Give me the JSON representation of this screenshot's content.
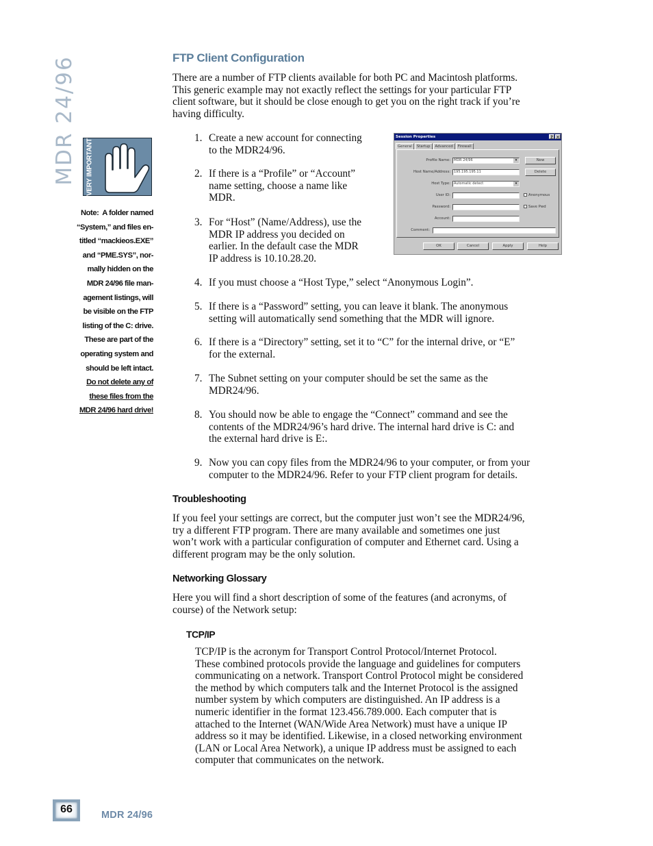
{
  "running_title": "MDR 24/96",
  "sidebar": {
    "icon_label": "VERY IMPORTANT",
    "note_label": "Note:",
    "note_lines": [
      "A folder named",
      "“System,” and files en-",
      "titled “mackieos.EXE”",
      "and “PME.SYS”, nor-",
      "mally hidden on the",
      "MDR 24/96 file man-",
      "agement listings, will",
      "be visible on the FTP",
      "listing of the C: drive.",
      "These are part of the",
      "operating system and",
      "should be left intact."
    ],
    "warning_lines": [
      "Do not delete any of",
      "these files from the",
      "MDR 24/96 hard drive!"
    ]
  },
  "main": {
    "section_title": "FTP Client Configuration",
    "intro_lines": [
      "There are a number of FTP clients available for both PC and Macintosh platforms.",
      "This generic example may not exactly reflect the settings for your particular FTP",
      "client software, but it should be close enough to get you on the right track if you’re",
      "having difficulty."
    ],
    "steps": [
      {
        "num": "1.",
        "lines": [
          "Create a new account for connecting",
          "to the MDR24/96."
        ]
      },
      {
        "num": "2.",
        "lines": [
          "If there is a “Profile” or “Account”",
          "name setting, choose a name like",
          "MDR."
        ]
      },
      {
        "num": "3.",
        "lines": [
          "For “Host” (Name/Address), use the",
          "MDR IP address you decided on",
          "earlier. In the default case the MDR",
          "IP address is 10.10.28.20."
        ]
      },
      {
        "num": "4.",
        "lines": [
          "If you must choose a “Host Type,” select “Anonymous Login”."
        ]
      },
      {
        "num": "5.",
        "lines": [
          "If there is a “Password” setting, you can leave it blank. The anonymous",
          "setting will automatically send something that the MDR will ignore."
        ]
      },
      {
        "num": "6.",
        "lines": [
          "If there is a “Directory” setting, set it to “C” for the internal drive, or “E”",
          "for the external."
        ]
      },
      {
        "num": "7.",
        "lines": [
          "The Subnet setting on your computer should be set the same as the",
          "MDR24/96."
        ]
      },
      {
        "num": "8.",
        "lines": [
          "You should now be able to engage the “Connect” command and see the",
          "contents of the MDR24/96’s hard drive. The internal hard drive is C: and",
          "the external hard drive is E:."
        ]
      },
      {
        "num": "9.",
        "lines": [
          "Now you can copy files from the MDR24/96 to your computer, or from your",
          "computer to the MDR24/96. Refer to your FTP client program for details."
        ]
      }
    ],
    "troubleshooting": {
      "title": "Troubleshooting",
      "lines": [
        "If you feel your settings are correct, but the computer just won’t see the MDR24/96,",
        "try a different FTP program. There are many available and sometimes one just",
        "won’t work with a particular configuration of computer and Ethernet card. Using a",
        "different program may be the only solution."
      ]
    },
    "glossary": {
      "title": "Networking Glossary",
      "lines": [
        "Here you will find a short description of some of the features (and acronyms, of",
        "course) of the Network setup:"
      ],
      "tcpip": {
        "title": "TCP/IP",
        "lines": [
          "TCP/IP is the acronym for Transport Control Protocol/Internet Protocol.",
          "These combined protocols provide the language and guidelines for computers",
          "communicating on a network. Transport Control Protocol might be considered",
          "the method by which computers talk and the Internet Protocol is the assigned",
          "number system by which computers are distinguished. An IP address is a",
          "numeric identifier in the format 123.456.789.000. Each computer that is",
          "attached to the Internet (WAN/Wide Area Network) must have a unique IP",
          "address so it may be identified. Likewise, in a closed networking environment",
          "(LAN or Local Area Network), a unique IP address must be assigned to each",
          "computer that communicates on the network."
        ]
      }
    }
  },
  "dialog": {
    "title": "Session Properties",
    "help_btn": "?",
    "close_btn": "✕",
    "tabs": [
      "General",
      "Startup",
      "Advanced",
      "Firewall"
    ],
    "fields": {
      "profile_name_label": "Profile Name:",
      "profile_name_value": "MDR 24/96",
      "host_label": "Host Name/Address:",
      "host_value": "195.195.195.11",
      "host_type_label": "Host Type:",
      "host_type_value": "Automatic detect",
      "user_id_label": "User ID:",
      "user_id_value": "",
      "password_label": "Password:",
      "password_value": "",
      "account_label": "Account:",
      "account_value": "",
      "comment_label": "Comment:",
      "comment_value": ""
    },
    "buttons": {
      "new": "New",
      "delete": "Delete",
      "ok": "OK",
      "cancel": "Cancel",
      "apply": "Apply",
      "help": "Help"
    },
    "checkboxes": {
      "anonymous": "Anonymous",
      "save_pwd": "Save Pwd"
    },
    "select_arrow": "▾"
  },
  "footer": {
    "page_number": "66",
    "product": "MDR 24/96"
  }
}
